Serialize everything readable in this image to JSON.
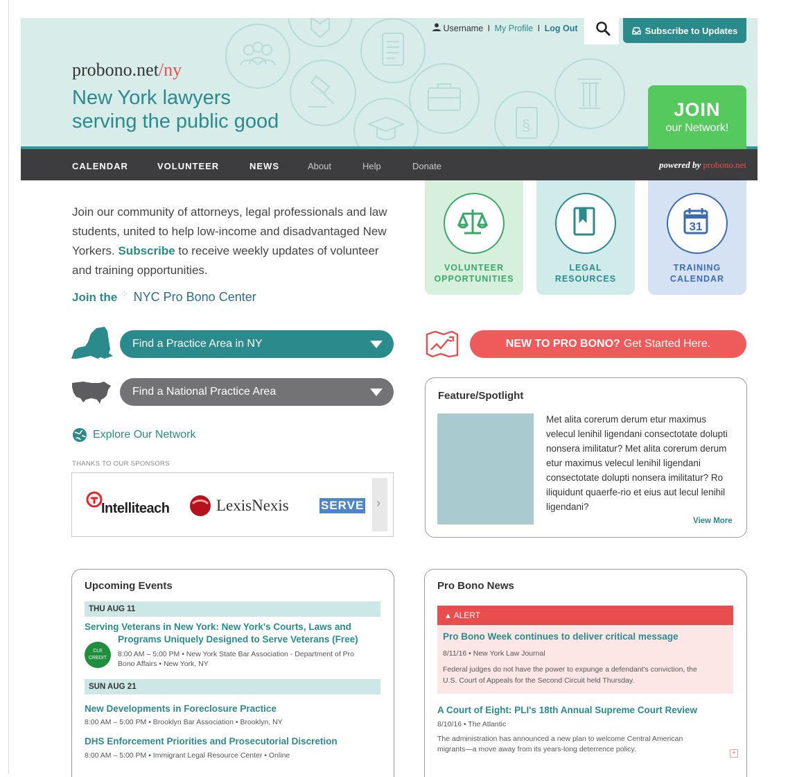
{
  "site": {
    "logo_main": "probono.net",
    "logo_sep": "/",
    "logo_ny": "ny",
    "tagline_1": "New York lawyers",
    "tagline_2": "serving the public good"
  },
  "topbar": {
    "username": "Username",
    "sep1": "I",
    "my_profile": "My Profile",
    "sep2": "I",
    "logout": "Log Out",
    "subscribe": "Subscribe to Updates"
  },
  "join": {
    "big": "JOIN",
    "small": "our Network!"
  },
  "nav": {
    "items": [
      "CALENDAR",
      "VOLUNTEER",
      "NEWS",
      "About",
      "Help",
      "Donate"
    ],
    "powered_by": "powered by",
    "powered_brand": "probono.net"
  },
  "intro": {
    "text_before": "Join our community of attorneys, legal professionals and law students, united to help low-income and disadvantaged New Yorkers. ",
    "subscribe": "Subscribe",
    "text_after": " to receive weekly updates of volunteer and training opportunities.",
    "join_the": "Join the",
    "center": "NYC Pro Bono Center"
  },
  "tiles": [
    {
      "line1": "VOLUNTEER",
      "line2": "OPPORTUNITIES",
      "icon": "scales-icon",
      "bg": "#d6f0dd",
      "color": "#3aa866"
    },
    {
      "line1": "LEGAL",
      "line2": "RESOURCES",
      "icon": "book-icon",
      "bg": "#d0ebea",
      "color": "#2a8a8c"
    },
    {
      "line1": "TRAINING",
      "line2": "CALENDAR",
      "icon": "calendar-icon",
      "cal_day": "31",
      "bg": "#d5e2f4",
      "color": "#3b6bb3"
    }
  ],
  "practice": {
    "ny": "Find a Practice Area in NY",
    "national": "Find a National Practice Area"
  },
  "new_pb": {
    "bold": "NEW TO PRO BONO?",
    "rest": "Get Started Here."
  },
  "explore": "Explore Our Network",
  "sponsors": {
    "title": "THANKS TO OUR SPONSORS",
    "items": [
      "Intelliteach",
      "LexisNexis",
      "SERVE"
    ]
  },
  "feature": {
    "title": "Feature/Spotlight",
    "text": "Met alita corerum derum etur maximus velecul lenihil ligendani consectotate dolupti nonsera imilitatur? Met alita corerum derum etur maximus velecul lenihil ligendani consectotate dolupti nonsera imilitatur? Ro iliquidunt quaerfe-rio et eius aut lecul lenihil ligendani?",
    "view_more": "View More"
  },
  "events": {
    "title": "Upcoming Events",
    "days": [
      {
        "label": "THU AUG 11"
      },
      {
        "label": "SUN AUG 21"
      }
    ],
    "items": [
      {
        "title_1": "Serving Veterans in New York: New York's Courts, Laws and",
        "title_2": "Programs Uniquely Designed to Serve Veterans (Free)",
        "meta_1": "8:00 AM – 5:00 PM • New York State Bar Association - Department of Pro",
        "meta_2": "Bono Affairs • New York, NY",
        "badge": "CLE CREDIT"
      },
      {
        "title": "New Developments in Foreclosure Practice",
        "meta": "8:00 AM – 5:00 PM • Brooklyn Bar Association • Brooklyn, NY"
      },
      {
        "title": "DHS Enforcement Priorities and Prosecutorial Discretion",
        "meta": "8:00 AM – 5:00 PM • Immigrant Legal Resource Center • Online"
      }
    ]
  },
  "news": {
    "title": "Pro Bono News",
    "alert_label": "ALERT",
    "items": [
      {
        "title": "Pro Bono Week continues to deliver critical message",
        "meta": "8/11/16 • New York Law Journal",
        "sum_1": "Federal judges do not have the power to expunge a defendant's conviction, the",
        "sum_2": "U.S. Court of Appeals for the Second Circuit held Thursday."
      },
      {
        "title": "A Court of Eight: PLI's 18th Annual Supreme Court Review",
        "meta": "8/10/16 • The Atlantic",
        "sum_1": "The administration has announced a new plan to welcome Central American",
        "sum_2": "migrants—a move away from its years-long deterrence policy."
      }
    ]
  },
  "colors": {
    "teal": "#2a8a8c",
    "green": "#55c95e",
    "red": "#e94d4d",
    "nav": "#3d3d3f",
    "hero": "#d8ecea"
  }
}
